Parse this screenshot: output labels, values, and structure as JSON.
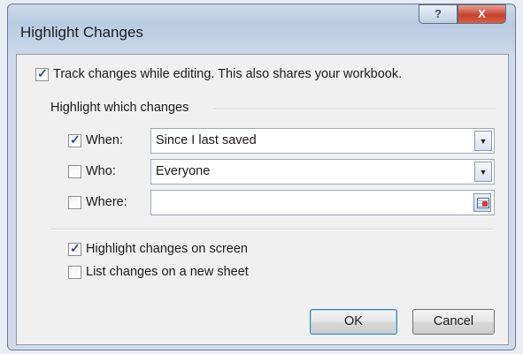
{
  "window": {
    "title": "Highlight Changes",
    "help_label": "?",
    "close_label": "X"
  },
  "track_changes": {
    "checked": true,
    "label": "Track changes while editing. This also shares your workbook."
  },
  "highlight_group": {
    "title": "Highlight which changes",
    "when": {
      "checked": true,
      "label": "When:",
      "value": "Since I last saved"
    },
    "who": {
      "checked": false,
      "label": "Who:",
      "value": "Everyone"
    },
    "where": {
      "checked": false,
      "label": "Where:",
      "value": ""
    }
  },
  "highlight_on_screen": {
    "checked": true,
    "label": "Highlight changes on screen"
  },
  "list_on_new_sheet": {
    "checked": false,
    "label": "List changes on a new sheet"
  },
  "buttons": {
    "ok": "OK",
    "cancel": "Cancel"
  },
  "icons": {
    "dropdown": "chevron-down-icon",
    "range_select": "range-select-icon",
    "check": "checkmark-icon"
  }
}
